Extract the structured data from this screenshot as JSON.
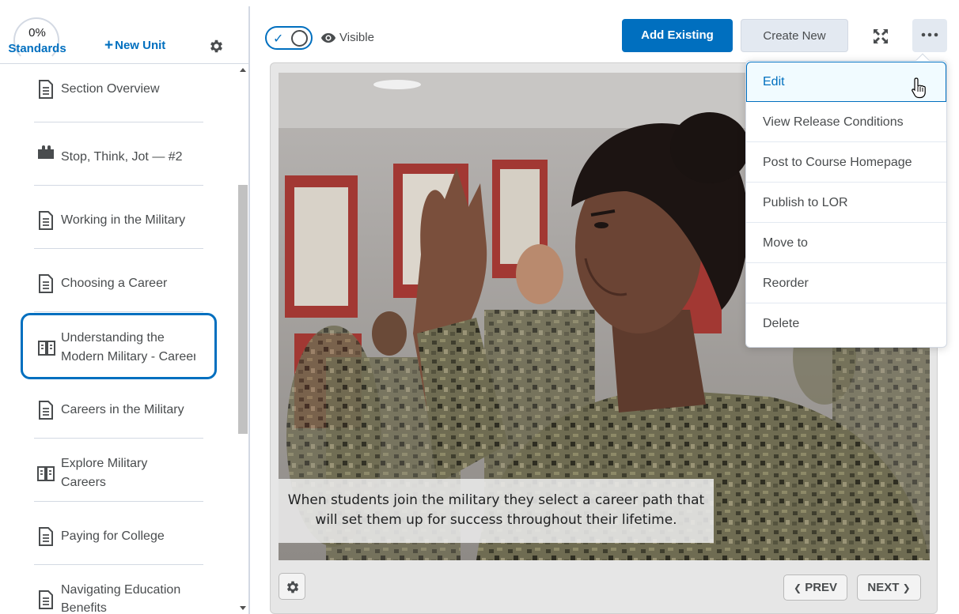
{
  "sidebar": {
    "standards_percent": "0%",
    "standards_label": "Standards",
    "new_unit_label": "New Unit",
    "items": [
      {
        "label": "Section Overview",
        "icon": "document-icon"
      },
      {
        "label": "Stop, Think, Jot — #2",
        "icon": "puzzle-icon"
      },
      {
        "label": "Working in the Military",
        "icon": "document-icon"
      },
      {
        "label": "Choosing a Career",
        "icon": "document-icon"
      },
      {
        "label_line1": "Understanding the",
        "label_line2": "Modern Military - Career",
        "icon": "book-icon",
        "selected": true
      },
      {
        "label": "Careers in the Military",
        "icon": "document-icon"
      },
      {
        "label_line1": "Explore Military",
        "label_line2": "Careers",
        "icon": "book-icon"
      },
      {
        "label": "Paying for College",
        "icon": "document-icon"
      },
      {
        "label_line1": "Navigating Education",
        "label_line2": "Benefits",
        "icon": "document-icon"
      }
    ]
  },
  "topbar": {
    "visibility_label": "Visible",
    "add_existing_label": "Add Existing",
    "create_new_label": "Create New"
  },
  "viewer": {
    "caption_line1": "When students join the military they select a career path that",
    "caption_line2": "will set them up for success throughout their lifetime.",
    "prev_label": "PREV",
    "next_label": "NEXT"
  },
  "menu": {
    "items": [
      {
        "label": "Edit",
        "hovered": true
      },
      {
        "label": "View Release Conditions"
      },
      {
        "label": "Post to Course Homepage"
      },
      {
        "label": "Publish to LOR"
      },
      {
        "label": "Move to"
      },
      {
        "label": "Reorder"
      },
      {
        "label": "Delete"
      }
    ]
  },
  "colors": {
    "accent": "#006fbf",
    "text": "#494c4e",
    "border": "#d3d9e3",
    "button_secondary": "#e3e9f1"
  }
}
